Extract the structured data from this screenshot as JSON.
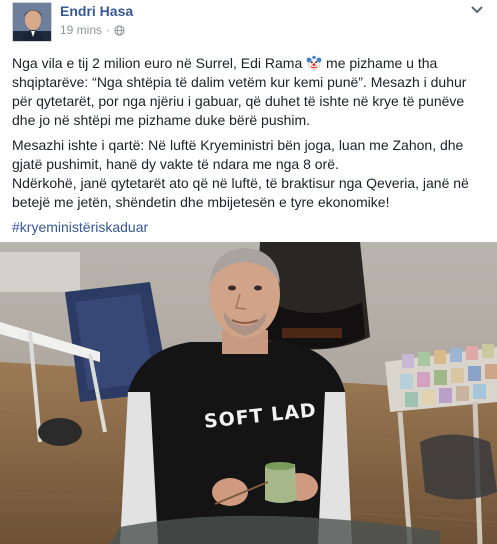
{
  "header": {
    "author_name": "Endri Hasa",
    "timestamp": "19 mins",
    "privacy_icon": "globe-icon",
    "menu_icon": "chevron-down-icon"
  },
  "post": {
    "para1_before_emoji": "Nga vila e tij 2 milion euro në Surrel, Edi Rama",
    "emoji": "clown-face-icon",
    "para1_after_emoji": " me pizhame u tha shqiptarëve: “Nga shtëpia të dalim vetëm kur kemi punë”. Mesazh i duhur për qytetarët, por nga njëriu i gabuar, që duhet të ishte në krye të punëve dhe jo në shtëpi me pizhame duke bërë pushim.",
    "para2": "Mesazhi ishte i qartë: Në luftë Kryeministri bën joga, luan me Zahon, dhe gjatë pushimit, hanë dy vakte të ndara me nga 8 orë.",
    "para3": "Ndërkohë, janë qytetarët ato që në luftë, të braktisur nga Qeveria, janë në betejë me jetën, shëndetin dhe mbijetesën e tyre ekonomike!",
    "hashtag": "#kryeministëriskaduar"
  },
  "photo": {
    "shirt_text": "SOFT LAD"
  }
}
